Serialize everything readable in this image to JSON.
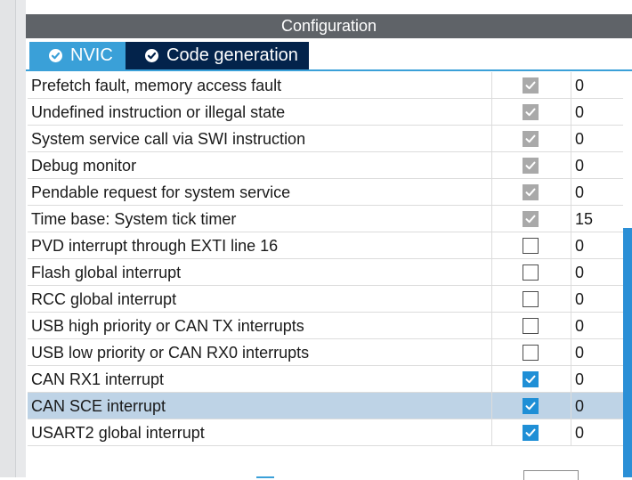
{
  "panel": {
    "title": "Configuration",
    "tabs": [
      {
        "label": "NVIC",
        "icon": "check-circle-icon"
      },
      {
        "label": "Code generation",
        "icon": "check-circle-icon"
      }
    ],
    "active_tab": "Code generation"
  },
  "colors": {
    "header_bg": "#5f6368",
    "tab_nvic_bg": "#3aa0d8",
    "tab_code_bg": "#03234b",
    "selected_row_bg": "#bed3e6",
    "checkbox_checked": "#1f8fd6",
    "checkbox_disabled": "#a9a9a9"
  },
  "rows": [
    {
      "name": "Prefetch fault, memory access fault",
      "checked": true,
      "enabled": false,
      "priority": "0"
    },
    {
      "name": "Undefined instruction or illegal state",
      "checked": true,
      "enabled": false,
      "priority": "0"
    },
    {
      "name": "System service call via SWI instruction",
      "checked": true,
      "enabled": false,
      "priority": "0"
    },
    {
      "name": "Debug monitor",
      "checked": true,
      "enabled": false,
      "priority": "0"
    },
    {
      "name": "Pendable request for system service",
      "checked": true,
      "enabled": false,
      "priority": "0"
    },
    {
      "name": "Time base: System tick timer",
      "checked": true,
      "enabled": false,
      "priority": "15"
    },
    {
      "name": "PVD interrupt through EXTI line 16",
      "checked": false,
      "enabled": true,
      "priority": "0"
    },
    {
      "name": "Flash global interrupt",
      "checked": false,
      "enabled": true,
      "priority": "0"
    },
    {
      "name": "RCC global interrupt",
      "checked": false,
      "enabled": true,
      "priority": "0"
    },
    {
      "name": "USB high priority or CAN TX interrupts",
      "checked": false,
      "enabled": true,
      "priority": "0"
    },
    {
      "name": "USB low priority or CAN RX0 interrupts",
      "checked": false,
      "enabled": true,
      "priority": "0"
    },
    {
      "name": "CAN RX1 interrupt",
      "checked": true,
      "enabled": true,
      "priority": "0"
    },
    {
      "name": "CAN SCE interrupt",
      "checked": true,
      "enabled": true,
      "priority": "0",
      "selected": true
    },
    {
      "name": "USART2 global interrupt",
      "checked": true,
      "enabled": true,
      "priority": "0"
    }
  ]
}
